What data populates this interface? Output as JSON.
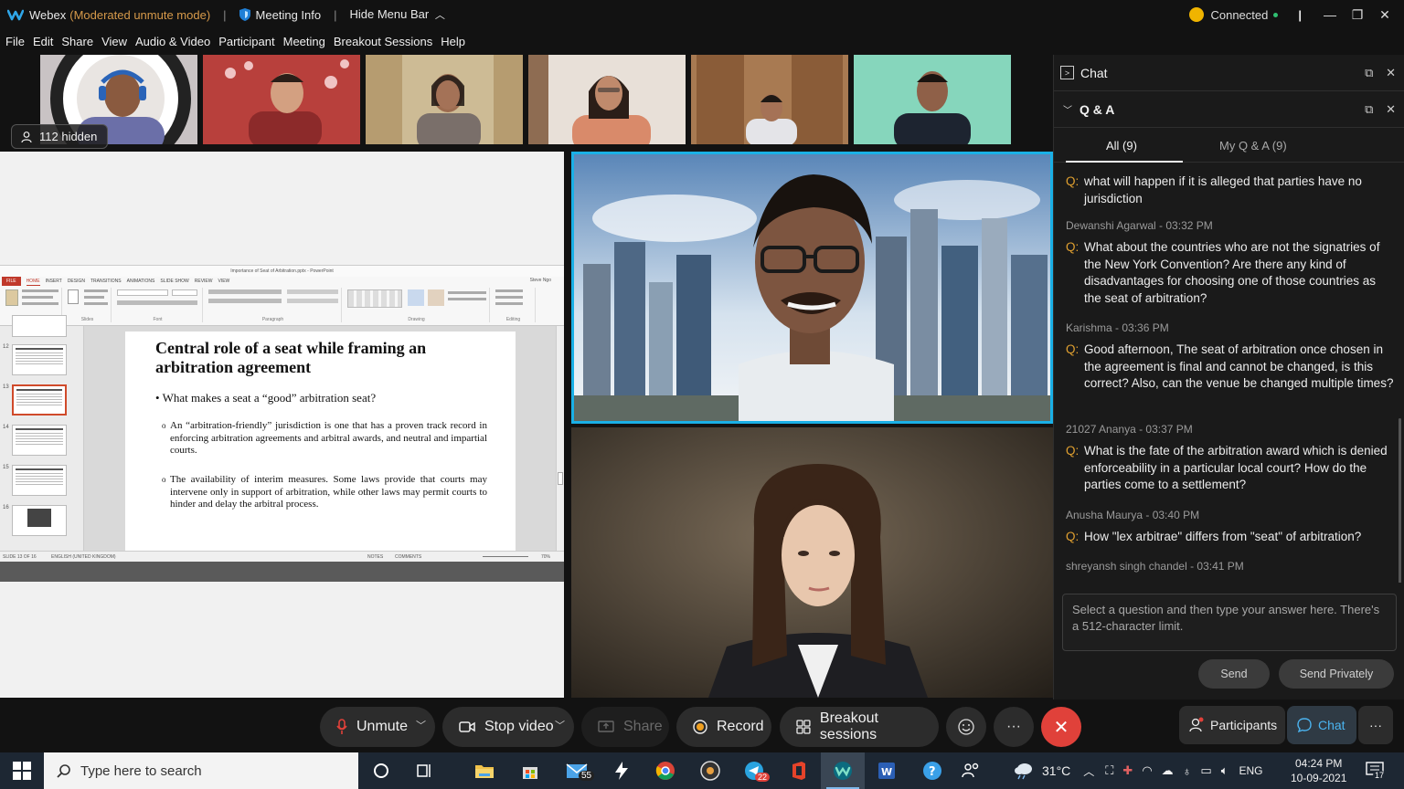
{
  "titlebar": {
    "app": "Webex",
    "mode": "(Moderated unmute mode)",
    "meeting_info": "Meeting Info",
    "hide_menu": "Hide Menu Bar",
    "connection": "Connected"
  },
  "menu": [
    "File",
    "Edit",
    "Share",
    "View",
    "Audio & Video",
    "Participant",
    "Meeting",
    "Breakout Sessions",
    "Help"
  ],
  "filmstrip": {
    "hidden_count": "112 hidden"
  },
  "ppt": {
    "window_title": "Importance of Seat of Arbitration.pptx - PowerPoint",
    "tabs": [
      "FILE",
      "HOME",
      "INSERT",
      "DESIGN",
      "TRANSITIONS",
      "ANIMATIONS",
      "SLIDE SHOW",
      "REVIEW",
      "VIEW"
    ],
    "user": "Steve Ngo",
    "groups": [
      "Clipboard",
      "Slides",
      "Font",
      "Paragraph",
      "Drawing",
      "Editing"
    ],
    "slide_numbers": [
      "12",
      "13",
      "14",
      "15",
      "16"
    ],
    "status_left": "SLIDE 13 OF 16",
    "status_lang": "ENGLISH (UNITED KINGDOM)",
    "status_notes": "NOTES",
    "status_comments": "COMMENTS",
    "zoom": "70%"
  },
  "slide": {
    "title": "Central role of a seat while framing an arbitration agreement",
    "bullet": "• What makes a seat a “good” arbitration seat?",
    "sub1": "An “arbitration-friendly” jurisdiction is one that has a proven track record in enforcing arbitration agreements and arbitral awards, and neutral and impartial courts.",
    "sub2": "The availability of interim measures.  Some laws provide that courts may intervene only in support of arbitration, while other laws may permit courts to hinder and delay the arbitral process."
  },
  "chat_panel": {
    "chat_label": "Chat",
    "qa_label": "Q & A",
    "tab_all": "All (9)",
    "tab_mine": "My Q & A (9)",
    "qmark": "Q:",
    "items": [
      {
        "meta": "",
        "question": "what will happen if it is alleged that parties have no jurisdiction"
      },
      {
        "meta": "Dewanshi Agarwal - 03:32 PM",
        "question": "What about the countries who are not the signatries of the New York Convention? Are there any kind of disadvantages for choosing one of those countries as the seat of arbitration?"
      },
      {
        "meta": "Karishma - 03:36 PM",
        "question": "Good afternoon, The seat of arbitration once chosen in the agreement is final and cannot be changed, is this correct? Also, can the venue be changed multiple times?"
      },
      {
        "meta": "21027 Ananya - 03:37 PM",
        "question": "What is the fate of the arbitration award which is denied enforceability in a particular local court? How do the parties come to a settlement?"
      },
      {
        "meta": "Anusha Maurya - 03:40 PM",
        "question": "How \"lex arbitrae\" differs from \"seat\" of arbitration?"
      },
      {
        "meta": "shreyansh singh chandel - 03:41 PM",
        "question": ""
      }
    ],
    "answer_placeholder": "Select a question and then type your answer here. There's a 512-character limit.",
    "send": "Send",
    "send_privately": "Send Privately"
  },
  "controls": {
    "unmute": "Unmute",
    "stop_video": "Stop video",
    "share": "Share",
    "record": "Record",
    "breakout": "Breakout sessions",
    "participants": "Participants",
    "chat": "Chat",
    "more": "···",
    "end": "✕"
  },
  "taskbar": {
    "search_placeholder": "Type here to search",
    "mail_badge": "55",
    "telegram_badge": "22",
    "temperature": "31°C",
    "lang": "ENG",
    "time": "04:24 PM",
    "date": "10-09-2021",
    "notif_count": "17"
  },
  "colors": {
    "active_speaker_border": "#1ab0e6",
    "end_call": "#e0413a",
    "mode_text": "#d79a4a",
    "question_mark": "#e0a030"
  }
}
